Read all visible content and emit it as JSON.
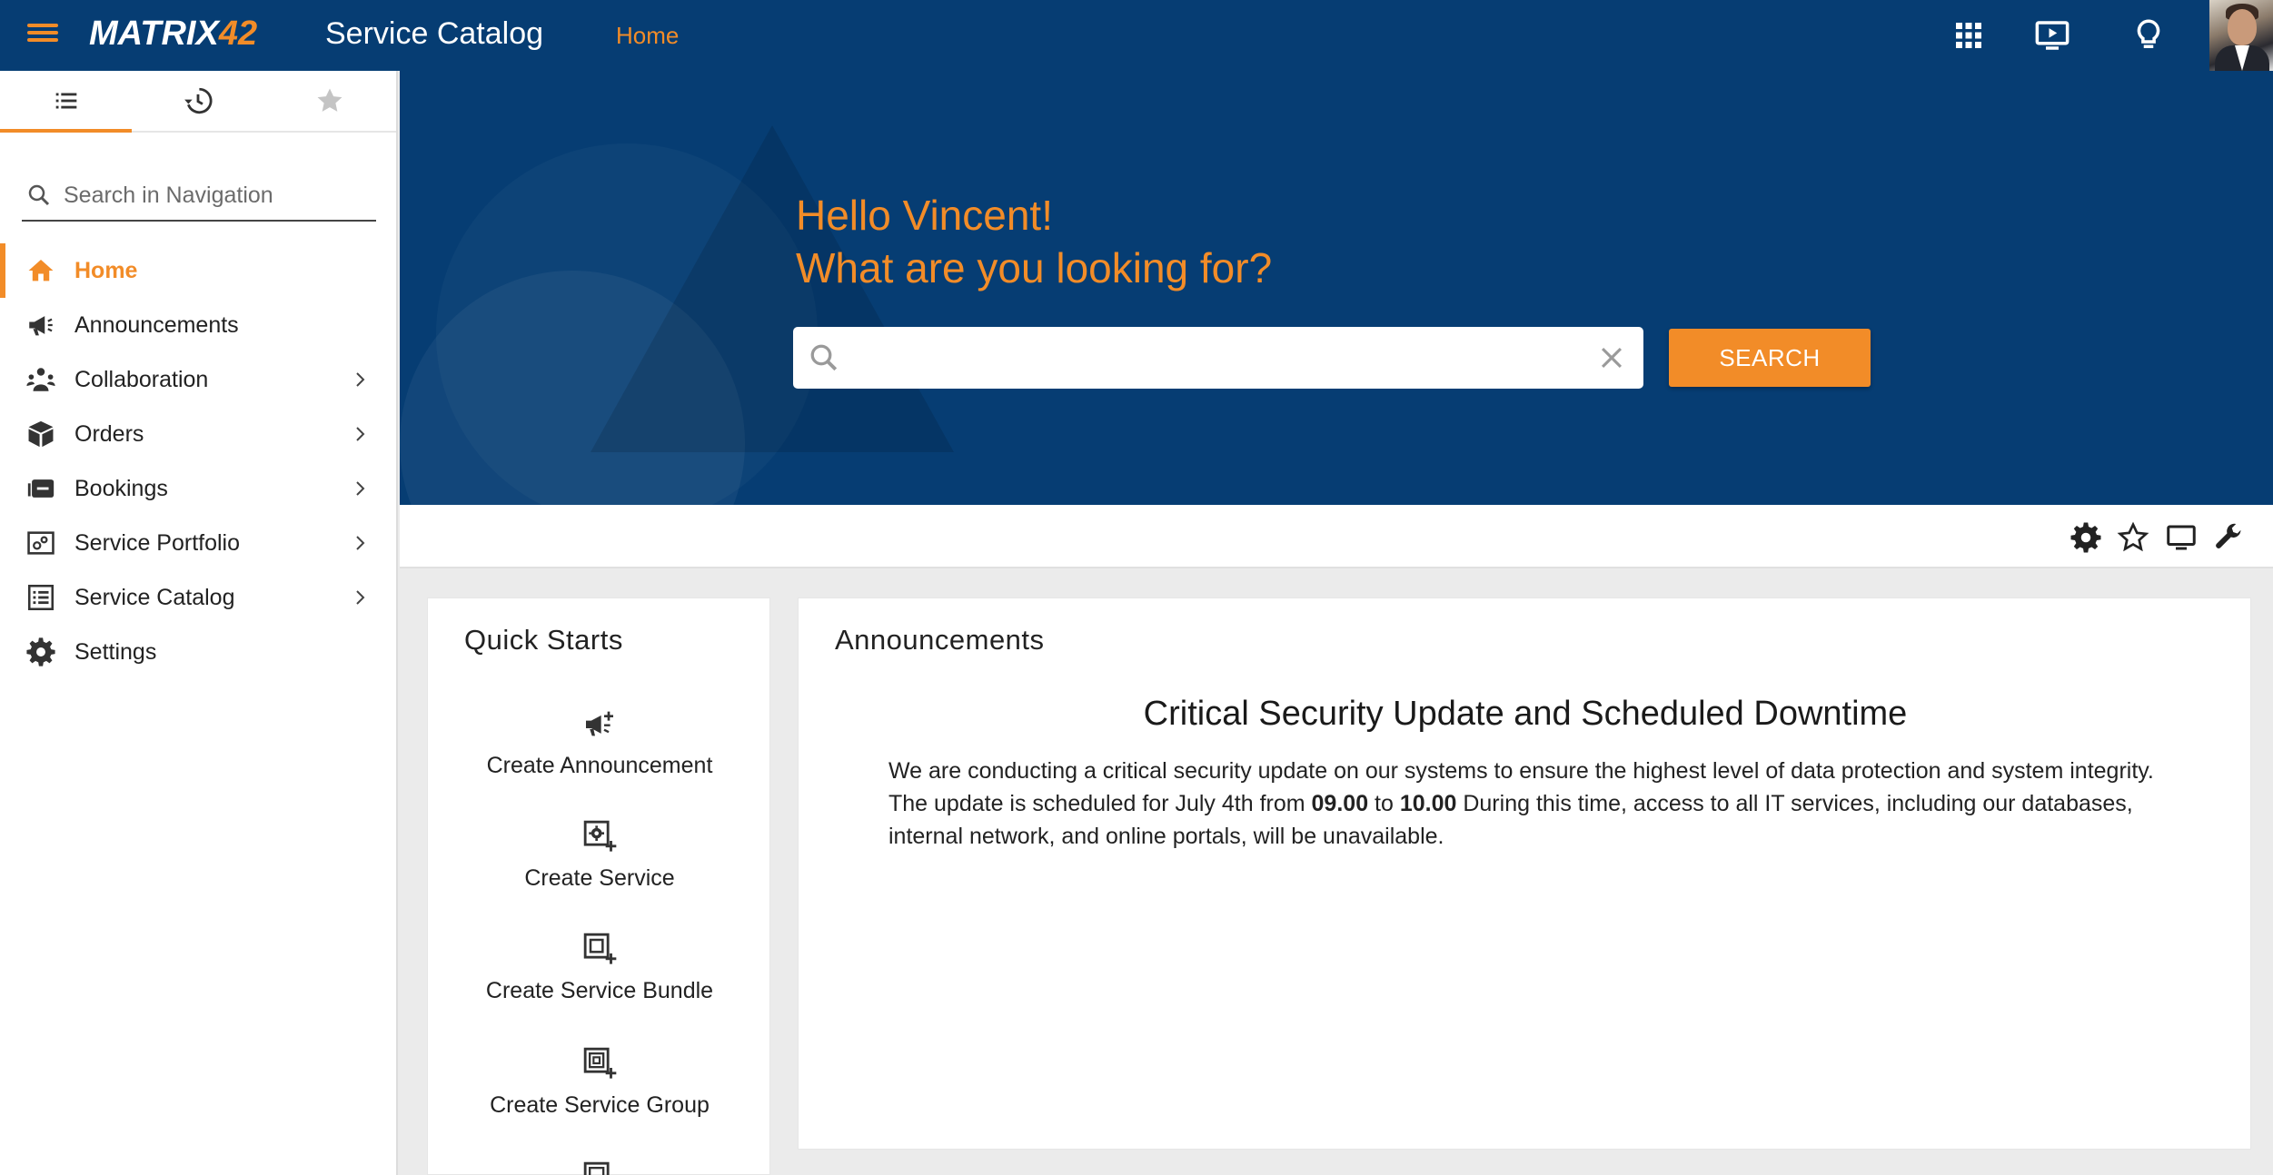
{
  "app": {
    "logo_main": "MATRIX",
    "logo_num": "42",
    "title": "Service Catalog",
    "breadcrumb_home": "Home"
  },
  "sidebar": {
    "search_placeholder": "Search in Navigation",
    "items": [
      {
        "label": "Home",
        "icon": "home-icon",
        "active": true
      },
      {
        "label": "Announcements",
        "icon": "megaphone-icon"
      },
      {
        "label": "Collaboration",
        "icon": "people-icon",
        "has_children": true
      },
      {
        "label": "Orders",
        "icon": "box-icon",
        "has_children": true
      },
      {
        "label": "Bookings",
        "icon": "booking-icon",
        "has_children": true
      },
      {
        "label": "Service Portfolio",
        "icon": "portfolio-icon",
        "has_children": true
      },
      {
        "label": "Service Catalog",
        "icon": "list-icon",
        "has_children": true
      },
      {
        "label": "Settings",
        "icon": "gear-icon"
      }
    ]
  },
  "hero": {
    "greeting": "Hello Vincent!",
    "question": "What are you looking for?",
    "search_value": "",
    "search_button": "SEARCH"
  },
  "quick_starts": {
    "title": "Quick Starts",
    "items": [
      {
        "label": "Create Announcement",
        "icon": "megaphone-plus-icon"
      },
      {
        "label": "Create Service",
        "icon": "service-plus-icon"
      },
      {
        "label": "Create Service Bundle",
        "icon": "bundle-plus-icon"
      },
      {
        "label": "Create Service Group",
        "icon": "group-plus-icon"
      }
    ]
  },
  "announcements": {
    "title": "Announcements",
    "headline": "Critical Security Update and Scheduled Downtime",
    "body_1": "We are conducting a critical security update on our systems to ensure the highest level of data protection and system integrity. The update is scheduled for July 4th from ",
    "time_start": "09.00",
    "body_2": " to ",
    "time_end": "10.00",
    "body_3": " During this time, access to all IT services, including our databases, internal network, and online portals, will be unavailable."
  },
  "colors": {
    "primary": "#063d73",
    "accent": "#f28c28"
  }
}
